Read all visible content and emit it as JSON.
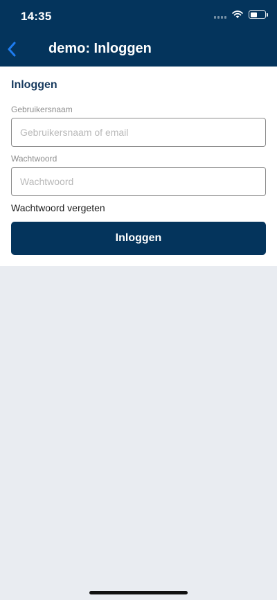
{
  "status_bar": {
    "time": "14:35",
    "signal_icon": "cellular-signal-icon",
    "wifi_icon": "wifi-icon",
    "battery_icon": "battery-icon",
    "battery_level": 0.45
  },
  "nav": {
    "back_icon": "chevron-left-icon",
    "title": "demo: Inloggen"
  },
  "form": {
    "section_title": "Inloggen",
    "username": {
      "label": "Gebruikersnaam",
      "value": "",
      "placeholder": "Gebruikersnaam of email"
    },
    "password": {
      "label": "Wachtwoord",
      "value": "",
      "placeholder": "Wachtwoord"
    },
    "forgot_link": "Wachtwoord vergeten",
    "submit_label": "Inloggen"
  },
  "colors": {
    "header_bg": "#04345c",
    "accent_blue": "#1e7cf0",
    "page_bg": "#e9ecf1",
    "section_title": "#173a5e"
  }
}
